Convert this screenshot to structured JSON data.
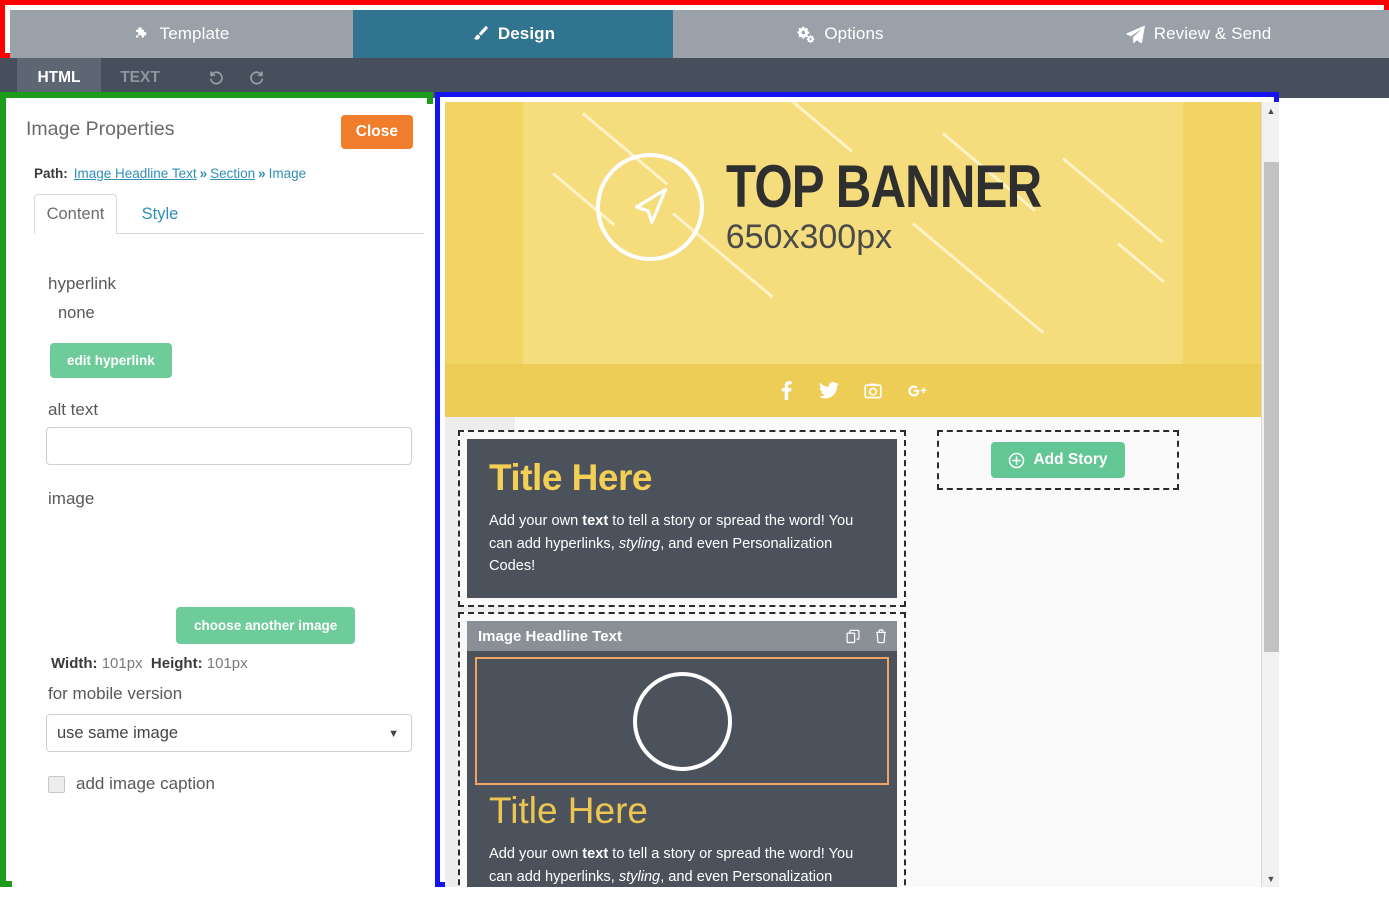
{
  "topnav": {
    "tabs": [
      {
        "label": "Template",
        "icon": "puzzle-icon",
        "active": false
      },
      {
        "label": "Design",
        "icon": "brush-icon",
        "active": true
      },
      {
        "label": "Options",
        "icon": "gears-icon",
        "active": false
      },
      {
        "label": "Review & Send",
        "icon": "paper-plane-icon",
        "active": false
      }
    ],
    "active_color": "#31748f",
    "inactive_color": "#9aa1a8",
    "highlight_color": "#ff0000"
  },
  "subbar": {
    "html_tab": "HTML",
    "text_tab": "TEXT",
    "undo_icon": "undo-icon",
    "redo_icon": "redo-icon",
    "background": "#474f5c"
  },
  "left_panel": {
    "highlight_color": "#1c9b1c",
    "title": "Image Properties",
    "close_label": "Close",
    "close_color": "#ef7d2c",
    "path": {
      "label": "Path:",
      "crumbs": [
        "Image Headline Text",
        "Section",
        "Image"
      ],
      "separator": "»",
      "link_color": "#2f8fb8"
    },
    "tabs": [
      {
        "label": "Content",
        "active": true
      },
      {
        "label": "Style",
        "active": false
      }
    ],
    "hyperlink_label": "hyperlink",
    "hyperlink_value": "none",
    "edit_hyperlink_label": "edit hyperlink",
    "alt_text_label": "alt text",
    "alt_text_value": "",
    "alt_text_placeholder": "",
    "image_label": "image",
    "choose_image_label": "choose another image",
    "width_label": "Width:",
    "width_value": "101px",
    "height_label": "Height:",
    "height_value": "101px",
    "mobile_label": "for mobile version",
    "mobile_value": "use same image",
    "mobile_options": [
      "use same image"
    ],
    "caption_label": "add image caption",
    "caption_checked": false,
    "button_color": "#6ecb9a"
  },
  "preview": {
    "highlight_color": "#1414f0",
    "banner": {
      "title": "TOP BANNER",
      "subtitle": "650x300px",
      "logo_icon": "paper-plane-circle-icon",
      "background": "#f2d463",
      "inner_background": "#f5dd7e"
    },
    "social": {
      "background": "#eecd56",
      "icons": [
        "facebook-icon",
        "twitter-icon",
        "instagram-icon",
        "google-plus-icon"
      ]
    },
    "stories": [
      {
        "title": "Title Here",
        "body_parts": [
          {
            "text": "Add your own ",
            "style": "normal"
          },
          {
            "text": "text",
            "style": "bold"
          },
          {
            "text": " to tell a story or spread the word! You can add hyperlinks, ",
            "style": "normal"
          },
          {
            "text": "styling",
            "style": "italic"
          },
          {
            "text": ", and even Personalization Codes!",
            "style": "normal"
          }
        ],
        "selected": false,
        "title_color": "#f3cf55",
        "card_background": "#4c525c"
      },
      {
        "header_label": "Image Headline Text",
        "copy_icon": "copy-icon",
        "delete_icon": "trash-icon",
        "image_placeholder_icon": "circle-placeholder-icon",
        "title": "Title Here",
        "body_parts": [
          {
            "text": "Add your own ",
            "style": "normal"
          },
          {
            "text": "text",
            "style": "bold"
          },
          {
            "text": " to tell a story or spread the word! You can add hyperlinks, ",
            "style": "normal"
          },
          {
            "text": "styling",
            "style": "italic"
          },
          {
            "text": ", and even Personalization",
            "style": "normal"
          }
        ],
        "selected": true,
        "selection_color": "#f0a566",
        "title_color": "#edc651",
        "card_background": "#4c525c"
      }
    ],
    "add_story": {
      "label": "Add Story",
      "icon": "plus-circle-icon",
      "color": "#62c795"
    },
    "scrollbar": {
      "up_icon": "scroll-up-arrow-icon",
      "down_icon": "scroll-down-arrow-icon"
    }
  }
}
